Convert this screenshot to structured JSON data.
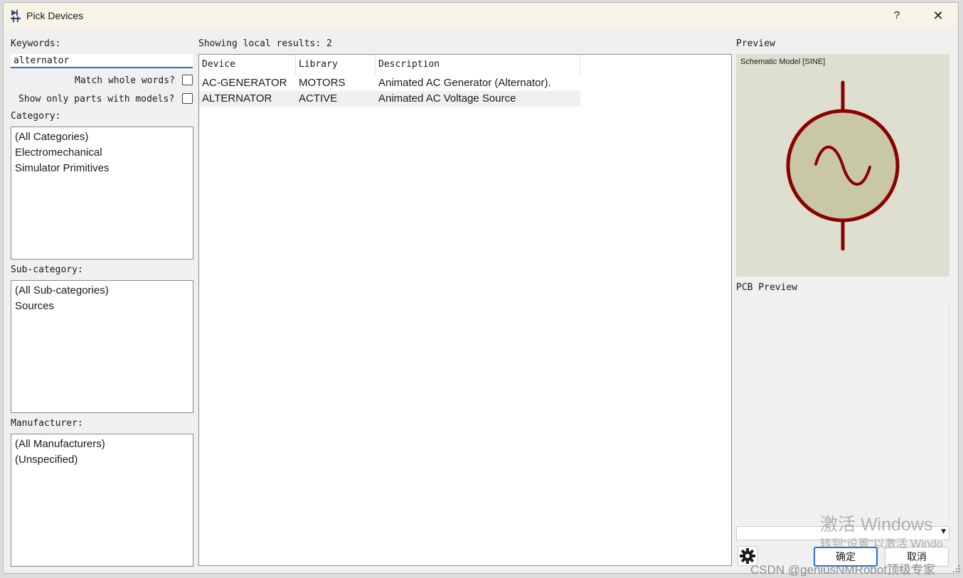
{
  "window": {
    "title": "Pick Devices",
    "help_label": "?",
    "close_label": "✕"
  },
  "left": {
    "keywords_label": "Keywords:",
    "keywords_value": "alternator",
    "match_whole_words_label": "Match whole words?",
    "show_only_models_label": "Show only parts with models?",
    "category_label": "Category:",
    "categories": [
      "(All Categories)",
      "Electromechanical",
      "Simulator Primitives"
    ],
    "subcategory_label": "Sub-category:",
    "subcategories": [
      "(All Sub-categories)",
      "Sources"
    ],
    "manufacturer_label": "Manufacturer:",
    "manufacturers": [
      "(All Manufacturers)",
      "(Unspecified)"
    ]
  },
  "results": {
    "summary": "Showing local results: 2",
    "columns": [
      "Device",
      "Library",
      "Description"
    ],
    "rows": [
      {
        "device": "AC-GENERATOR",
        "library": "MOTORS",
        "description": "Animated AC Generator (Alternator)."
      },
      {
        "device": "ALTERNATOR",
        "library": "ACTIVE",
        "description": "Animated AC Voltage Source"
      }
    ],
    "selected_row": 1
  },
  "preview": {
    "label": "Preview",
    "caption": "Schematic Model [SINE]",
    "symbol_icon": "ac-sine-source-icon",
    "symbol_color": "#8b0000",
    "background_color": "#dedfd0"
  },
  "pcb": {
    "label": "PCB Preview"
  },
  "footer": {
    "ok_label": "确定",
    "cancel_label": "取消",
    "settings_icon": "gear-icon"
  },
  "watermarks": {
    "activate_title": "激活 Windows",
    "activate_hint": "转到“设置”以激活 Windo",
    "csdn": "CSDN @geniusNMRobot顶级专家"
  },
  "accent_color": "#2a6fd6"
}
